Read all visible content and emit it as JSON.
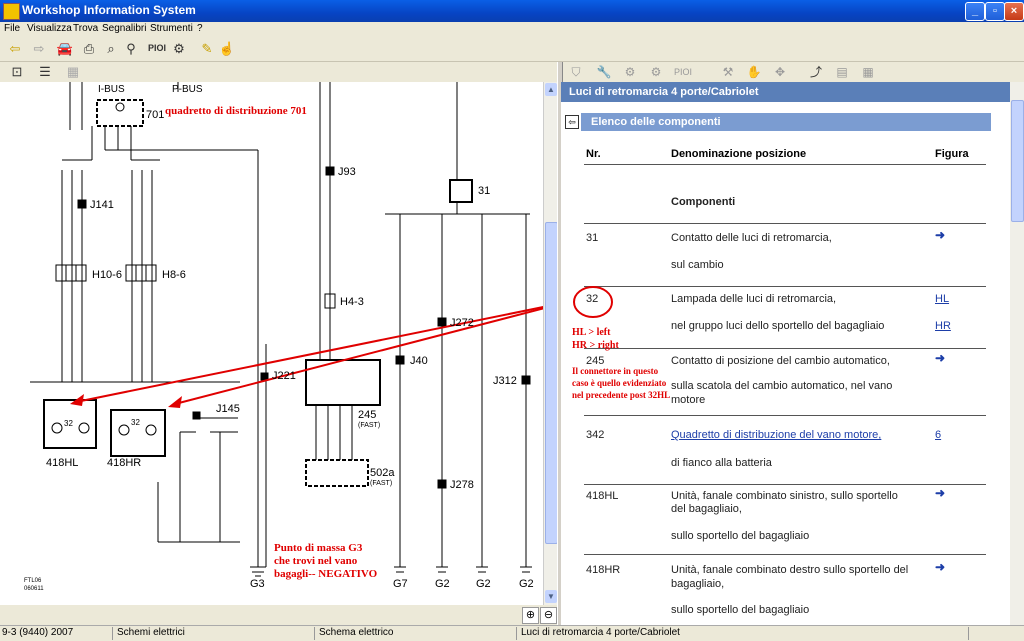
{
  "window": {
    "title": "Workshop Information System"
  },
  "menu": [
    "File",
    "Visualizza",
    "Trova",
    "Segnalibri",
    "Strumenti",
    "?"
  ],
  "toolbar": {
    "pioi_label": "PIOI"
  },
  "right_toolbar": {
    "pioi_label": "PIOI"
  },
  "diagram": {
    "labels": {
      "ibus": "I-BUS",
      "pbus": "P-BUS",
      "dist701": "701",
      "j93": "J93",
      "j141": "J141",
      "h10": "H10-6",
      "h8": "H8-6",
      "h4": "H4-3",
      "c31": "31",
      "j272": "J272",
      "j40": "J40",
      "j312": "J312",
      "j221": "J221",
      "j145": "J145",
      "c245": "245",
      "fast": "(FAST)",
      "c502a": "502a",
      "fast2": "(FAST)",
      "j278": "J278",
      "c418hl": "418HL",
      "c418hr": "418HR",
      "num32a": "32",
      "num32b": "32",
      "g3": "G3",
      "g7": "G7",
      "g2a": "G2",
      "g2b": "G2",
      "g2c": "G2",
      "code1": "FTL06",
      "code2": "060611"
    },
    "annotations": {
      "quadretto": "quadretto di distribuzione 701",
      "hl": "HL  > left",
      "hr": "HR > right",
      "connettore1": "Il connettore in questo",
      "connettore2": "caso è quello evidenziato",
      "connettore3": "nel precedente post 32HL",
      "massa1": "Punto di massa G3",
      "massa2": "che trovi nel vano",
      "massa3": "bagagli-- NEGATIVO"
    }
  },
  "panel": {
    "title": "Luci di retromarcia 4 porte/Cabriolet",
    "section": "Elenco delle componenti",
    "columns": {
      "nr": "Nr.",
      "name": "Denominazione posizione",
      "fig": "Figura"
    },
    "group": "Componenti",
    "rows": [
      {
        "nr": "31",
        "l1": "Contatto delle luci di retromarcia,",
        "l2": "sul cambio",
        "fig": "arrow-icon"
      },
      {
        "nr": "32",
        "l1": "Lampada delle luci di retromarcia,",
        "l2": "nel gruppo luci dello sportello del bagagliaio",
        "fig1": "HL",
        "fig2": "HR"
      },
      {
        "nr": "245",
        "l1": "Contatto di posizione del cambio automatico,",
        "l2": "sulla scatola del cambio automatico, nel vano",
        "l3": "motore",
        "fig": "arrow-icon"
      },
      {
        "nr": "342",
        "l1": "Quadretto di distribuzione del vano motore,",
        "l2": "di fianco alla batteria",
        "fig": "6"
      },
      {
        "nr": "418HL",
        "l1": "Unità, fanale combinato sinistro, sullo sportello",
        "l2": "del bagagliaio,",
        "l3": "sullo sportello del bagagliaio",
        "fig": "arrow-icon"
      },
      {
        "nr": "418HR",
        "l1": "Unità, fanale combinato destro sullo sportello del",
        "l2": "bagagliaio,",
        "l3": "sullo sportello del bagagliaio",
        "fig": "arrow-icon"
      }
    ]
  },
  "status": {
    "s1": "9-3 (9440) 2007",
    "s2": "Schemi elettrici",
    "s3": "Schema elettrico",
    "s4": "Luci di retromarcia 4 porte/Cabriolet"
  },
  "colors": {
    "titlebar": "#0a5fe6",
    "panel_header": "#5a7fb8",
    "section_header": "#7b9cd1",
    "annotation_red": "#e00000",
    "link": "#1d3ea8"
  }
}
